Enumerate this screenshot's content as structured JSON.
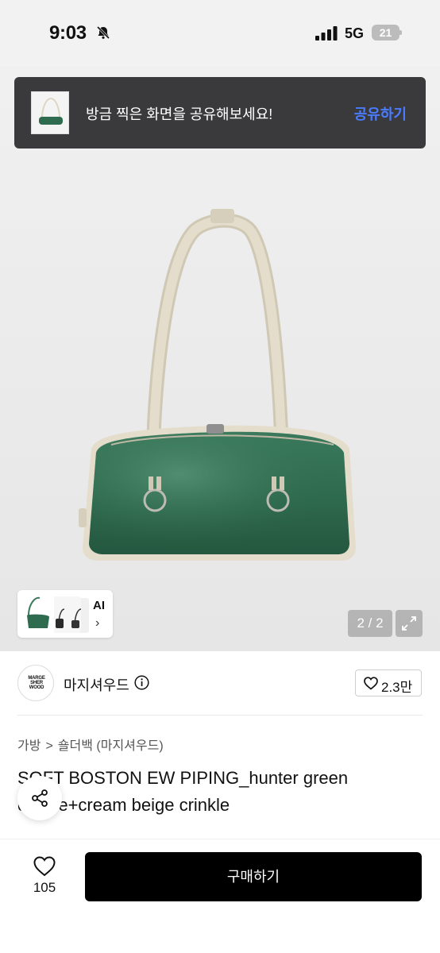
{
  "status_bar": {
    "time": "9:03",
    "network": "5G",
    "battery": "21"
  },
  "share_banner": {
    "message": "방금 찍은 화면을 공유해보세요!",
    "action": "공유하기"
  },
  "gallery": {
    "ai_label": "AI",
    "ai_chevron": "›",
    "page_indicator": "2 / 2",
    "expand_icon": "expand-icon"
  },
  "seller": {
    "logo_lines": [
      "MARGE",
      "SHER",
      "WOOD"
    ],
    "name": "마지셔우드",
    "like_count": "2.3만"
  },
  "breadcrumb": {
    "level1": "가방",
    "separator": ">",
    "level2": "숄더백 (마지셔우드)"
  },
  "product": {
    "title": "SOFT BOSTON EW PIPING_hunter green crinkle+cream beige crinkle"
  },
  "bottom_bar": {
    "wish_count": "105",
    "buy_label": "구매하기"
  },
  "colors": {
    "accent_blue": "#4a7cff",
    "bag_green": "#2f6b4f",
    "piping_beige": "#ddd6c4",
    "banner_bg": "#3a3a3c",
    "buy_button": "#000000"
  }
}
